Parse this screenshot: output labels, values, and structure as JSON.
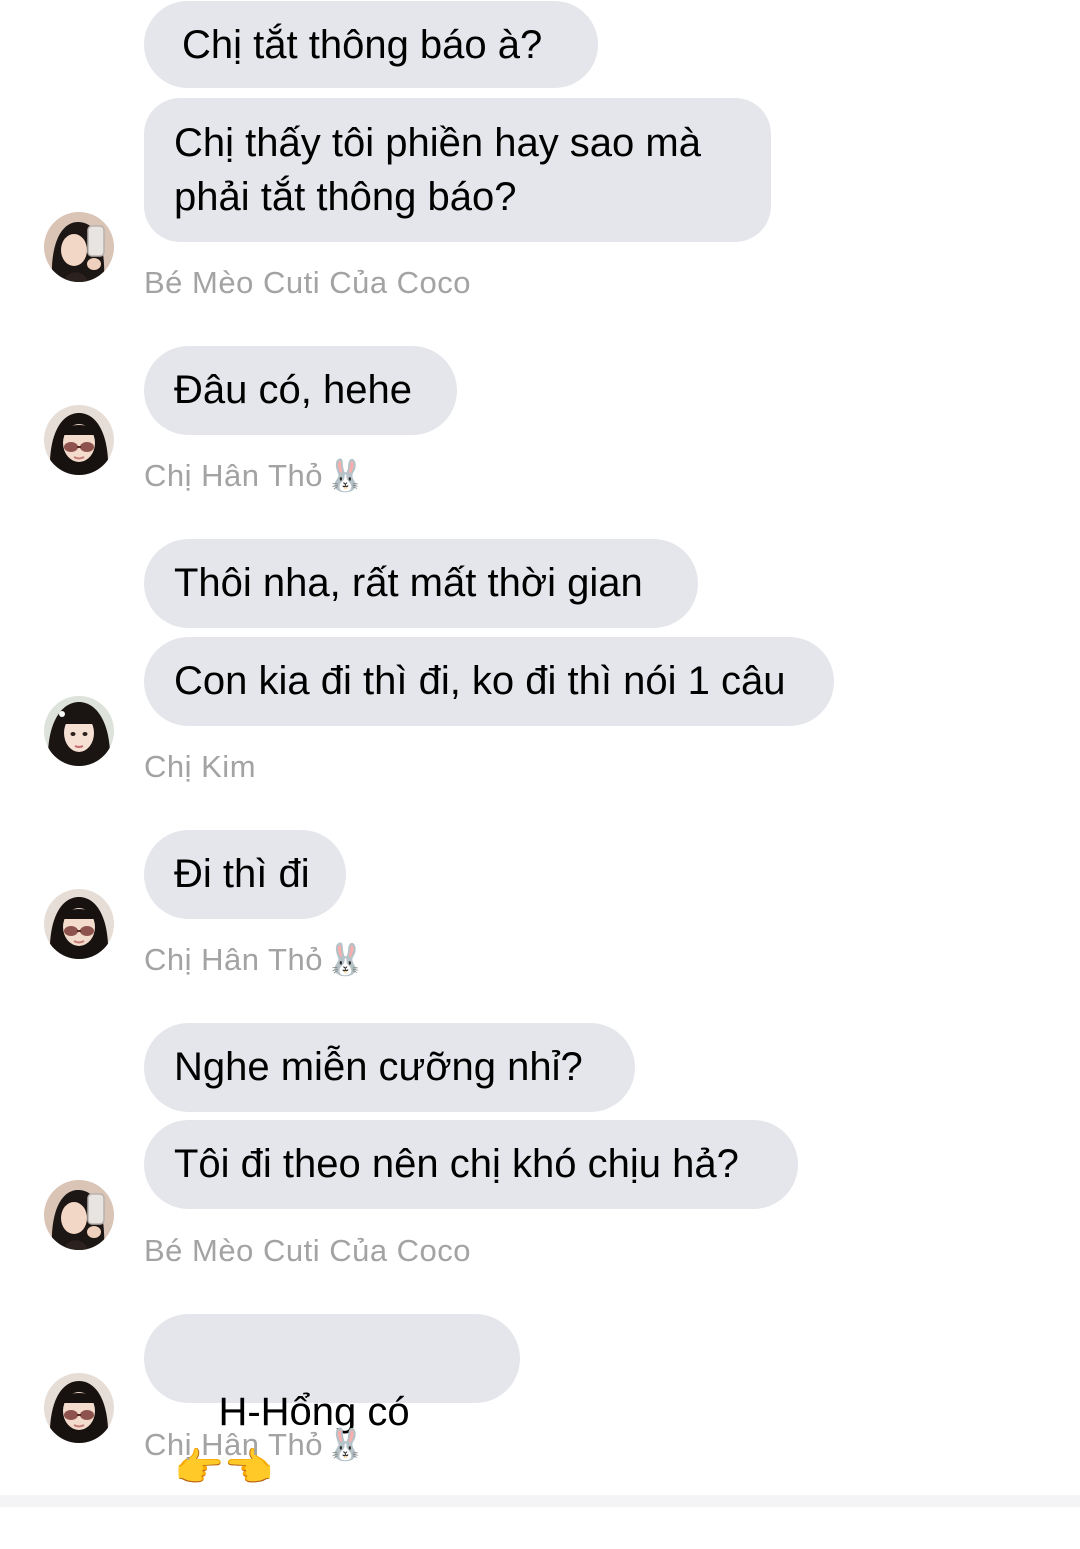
{
  "messages": [
    {
      "bubbles": [
        "Chị tắt thông báo à?",
        "Chị thấy tôi phiền hay sao mà\nphải tắt thông báo?"
      ],
      "sender": "Bé Mèo Cuti Của Coco",
      "sender_emoji": "",
      "avatar": "phone-selfie-avatar"
    },
    {
      "bubbles": [
        "Đâu có, hehe"
      ],
      "sender": "Chị Hân Thỏ",
      "sender_emoji": "🐰",
      "avatar": "sunglasses-avatar"
    },
    {
      "bubbles": [
        "Thôi nha, rất mất thời gian",
        "Con kia đi thì đi, ko đi thì nói 1 câu"
      ],
      "sender": "Chị Kim",
      "sender_emoji": "",
      "avatar": "long-hair-avatar"
    },
    {
      "bubbles": [
        "Đi thì đi"
      ],
      "sender": "Chị Hân Thỏ",
      "sender_emoji": "🐰",
      "avatar": "sunglasses-avatar"
    },
    {
      "bubbles": [
        "Nghe miễn cưỡng nhỉ?",
        "Tôi đi theo nên chị khó chịu hả?"
      ],
      "sender": "Bé Mèo Cuti Của Coco",
      "sender_emoji": "",
      "avatar": "phone-selfie-avatar"
    },
    {
      "bubbles": [
        "H-Hổng có"
      ],
      "bubble_emoji": "👉👈",
      "sender": "Chị Hân Thỏ",
      "sender_emoji": "🐰",
      "avatar": "sunglasses-avatar"
    }
  ]
}
